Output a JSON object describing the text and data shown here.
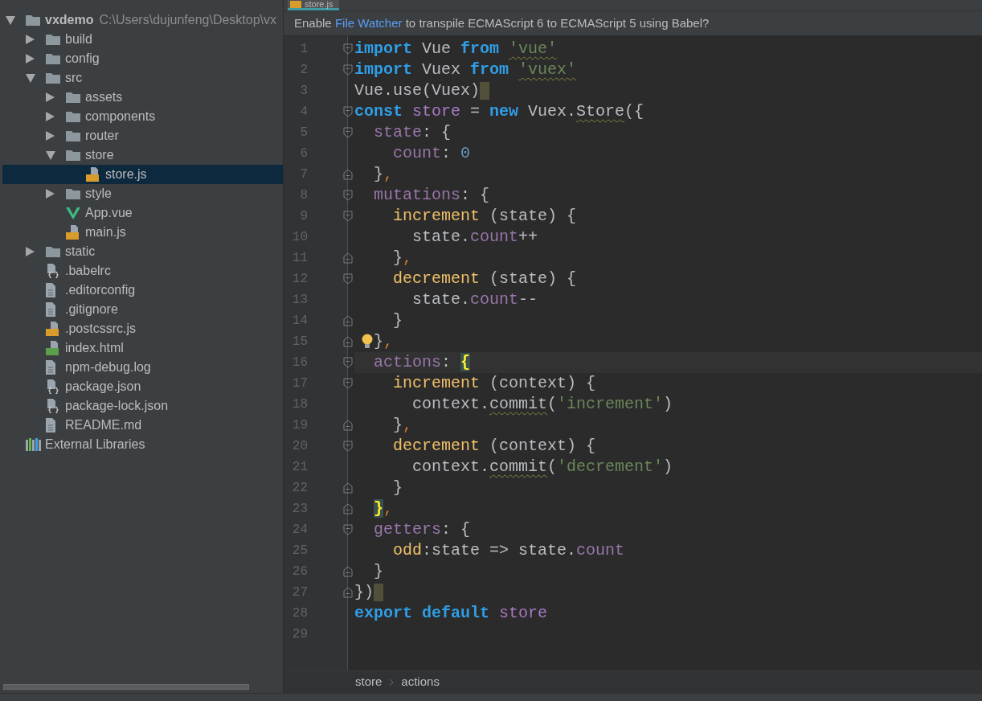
{
  "project_tree": {
    "items": [
      {
        "name": "vxdemo",
        "kind": "project",
        "path": "C:\\Users\\dujunfeng\\Desktop\\vx",
        "expanded": true,
        "selected": false,
        "children": [
          {
            "name": "build",
            "kind": "folder",
            "expanded": false,
            "selected": false
          },
          {
            "name": "config",
            "kind": "folder",
            "expanded": false,
            "selected": false
          },
          {
            "name": "src",
            "kind": "folder",
            "expanded": true,
            "selected": false,
            "children": [
              {
                "name": "assets",
                "kind": "folder",
                "expanded": false,
                "selected": false
              },
              {
                "name": "components",
                "kind": "folder",
                "expanded": false,
                "selected": false
              },
              {
                "name": "router",
                "kind": "folder",
                "expanded": false,
                "selected": false
              },
              {
                "name": "store",
                "kind": "folder",
                "expanded": true,
                "selected": false,
                "children": [
                  {
                    "name": "store.js",
                    "kind": "js",
                    "selected": true
                  }
                ]
              },
              {
                "name": "style",
                "kind": "folder",
                "expanded": false,
                "selected": false
              },
              {
                "name": "App.vue",
                "kind": "vue",
                "selected": false
              },
              {
                "name": "main.js",
                "kind": "js",
                "selected": false
              }
            ]
          },
          {
            "name": "static",
            "kind": "folder",
            "expanded": false,
            "selected": false
          },
          {
            "name": ".babelrc",
            "kind": "json",
            "selected": false
          },
          {
            "name": ".editorconfig",
            "kind": "text",
            "selected": false
          },
          {
            "name": ".gitignore",
            "kind": "text",
            "selected": false
          },
          {
            "name": ".postcssrc.js",
            "kind": "js",
            "selected": false
          },
          {
            "name": "index.html",
            "kind": "html",
            "selected": false
          },
          {
            "name": "npm-debug.log",
            "kind": "text",
            "selected": false
          },
          {
            "name": "package.json",
            "kind": "json",
            "selected": false
          },
          {
            "name": "package-lock.json",
            "kind": "json",
            "selected": false
          },
          {
            "name": "README.md",
            "kind": "text",
            "selected": false
          }
        ]
      },
      {
        "name": "External Libraries",
        "kind": "libraries",
        "selected": false
      }
    ]
  },
  "editor": {
    "tabs": [
      {
        "label": "store.js",
        "kind": "js",
        "selected": true
      }
    ],
    "notification": {
      "parts": [
        {
          "text": "Enable",
          "kind": "text"
        },
        {
          "text": "File Watcher",
          "kind": "link"
        },
        {
          "text": "to transpile ECMAScript 6 to ECMAScript 5 using Babel?",
          "kind": "text"
        }
      ]
    },
    "lines": [
      {
        "number": "1",
        "kind": "fold_start",
        "current": false,
        "bulb": false,
        "end_mark": false,
        "tokens": [
          {
            "text": "import",
            "kind": "keyword"
          },
          {
            "text": " Vue ",
            "kind": "plain"
          },
          {
            "text": "from ",
            "kind": "keyword"
          },
          {
            "text": "'vue'",
            "kind": "string",
            "squiggly": true
          }
        ]
      },
      {
        "number": "2",
        "kind": "fold_start",
        "current": false,
        "bulb": false,
        "end_mark": false,
        "tokens": [
          {
            "text": "import",
            "kind": "keyword"
          },
          {
            "text": " Vuex ",
            "kind": "plain"
          },
          {
            "text": "from ",
            "kind": "keyword"
          },
          {
            "text": "'vuex'",
            "kind": "string",
            "squiggly": true
          }
        ]
      },
      {
        "number": "3",
        "kind": "plain",
        "current": false,
        "bulb": false,
        "end_mark": true,
        "tokens": [
          {
            "text": "Vue.use(Vuex)",
            "kind": "plain"
          }
        ]
      },
      {
        "number": "4",
        "kind": "fold_start",
        "current": false,
        "bulb": false,
        "end_mark": false,
        "tokens": [
          {
            "text": "const ",
            "kind": "keyword"
          },
          {
            "text": "store",
            "kind": "variable"
          },
          {
            "text": " = ",
            "kind": "plain"
          },
          {
            "text": "new",
            "kind": "keyword"
          },
          {
            "text": " Vuex.",
            "kind": "plain"
          },
          {
            "text": "Store",
            "kind": "plain",
            "squiggly": true
          },
          {
            "text": "({",
            "kind": "plain"
          }
        ]
      },
      {
        "number": "5",
        "kind": "fold_start",
        "current": false,
        "bulb": false,
        "end_mark": false,
        "tokens": [
          {
            "text": "  state",
            "kind": "property"
          },
          {
            "text": ": {",
            "kind": "plain"
          }
        ]
      },
      {
        "number": "6",
        "kind": "plain",
        "current": false,
        "bulb": false,
        "end_mark": false,
        "tokens": [
          {
            "text": "    count",
            "kind": "property"
          },
          {
            "text": ": ",
            "kind": "plain"
          },
          {
            "text": "0",
            "kind": "number"
          }
        ]
      },
      {
        "number": "7",
        "kind": "fold_end",
        "current": false,
        "bulb": false,
        "end_mark": false,
        "tokens": [
          {
            "text": "  }",
            "kind": "plain"
          },
          {
            "text": ",",
            "kind": "comma"
          }
        ]
      },
      {
        "number": "8",
        "kind": "fold_start",
        "current": false,
        "bulb": false,
        "end_mark": false,
        "tokens": [
          {
            "text": "  mutations",
            "kind": "property"
          },
          {
            "text": ": {",
            "kind": "plain"
          }
        ]
      },
      {
        "number": "9",
        "kind": "fold_start",
        "current": false,
        "bulb": false,
        "end_mark": false,
        "tokens": [
          {
            "text": "    increment",
            "kind": "function"
          },
          {
            "text": " (state) {",
            "kind": "plain"
          }
        ]
      },
      {
        "number": "10",
        "kind": "plain",
        "current": false,
        "bulb": false,
        "end_mark": false,
        "tokens": [
          {
            "text": "      state.",
            "kind": "plain"
          },
          {
            "text": "count",
            "kind": "property"
          },
          {
            "text": "++",
            "kind": "plain"
          }
        ]
      },
      {
        "number": "11",
        "kind": "fold_end",
        "current": false,
        "bulb": false,
        "end_mark": false,
        "tokens": [
          {
            "text": "    }",
            "kind": "plain"
          },
          {
            "text": ",",
            "kind": "comma"
          }
        ]
      },
      {
        "number": "12",
        "kind": "fold_start",
        "current": false,
        "bulb": false,
        "end_mark": false,
        "tokens": [
          {
            "text": "    decrement",
            "kind": "function"
          },
          {
            "text": " (state) {",
            "kind": "plain"
          }
        ]
      },
      {
        "number": "13",
        "kind": "plain",
        "current": false,
        "bulb": false,
        "end_mark": false,
        "tokens": [
          {
            "text": "      state.",
            "kind": "plain"
          },
          {
            "text": "count",
            "kind": "property"
          },
          {
            "text": "--",
            "kind": "plain"
          }
        ]
      },
      {
        "number": "14",
        "kind": "fold_end",
        "current": false,
        "bulb": false,
        "end_mark": false,
        "tokens": [
          {
            "text": "    }",
            "kind": "plain"
          }
        ]
      },
      {
        "number": "15",
        "kind": "fold_end",
        "current": false,
        "bulb": true,
        "end_mark": false,
        "tokens": [
          {
            "text": "  }",
            "kind": "plain"
          },
          {
            "text": ",",
            "kind": "comma"
          }
        ]
      },
      {
        "number": "16",
        "kind": "fold_start",
        "current": true,
        "bulb": false,
        "end_mark": false,
        "tokens": [
          {
            "text": "  actions",
            "kind": "property"
          },
          {
            "text": ": ",
            "kind": "plain"
          },
          {
            "text": "{",
            "kind": "brace"
          }
        ]
      },
      {
        "number": "17",
        "kind": "fold_start",
        "current": false,
        "bulb": false,
        "end_mark": false,
        "tokens": [
          {
            "text": "    increment",
            "kind": "function"
          },
          {
            "text": " (context) {",
            "kind": "plain"
          }
        ]
      },
      {
        "number": "18",
        "kind": "plain",
        "current": false,
        "bulb": false,
        "end_mark": false,
        "tokens": [
          {
            "text": "      context.",
            "kind": "plain"
          },
          {
            "text": "commit",
            "kind": "plain",
            "squiggly": true
          },
          {
            "text": "(",
            "kind": "plain"
          },
          {
            "text": "'increment'",
            "kind": "string"
          },
          {
            "text": ")",
            "kind": "plain"
          }
        ]
      },
      {
        "number": "19",
        "kind": "fold_end",
        "current": false,
        "bulb": false,
        "end_mark": false,
        "tokens": [
          {
            "text": "    }",
            "kind": "plain"
          },
          {
            "text": ",",
            "kind": "comma"
          }
        ]
      },
      {
        "number": "20",
        "kind": "fold_start",
        "current": false,
        "bulb": false,
        "end_mark": false,
        "tokens": [
          {
            "text": "    decrement",
            "kind": "function"
          },
          {
            "text": " (context) {",
            "kind": "plain"
          }
        ]
      },
      {
        "number": "21",
        "kind": "plain",
        "current": false,
        "bulb": false,
        "end_mark": false,
        "tokens": [
          {
            "text": "      context.",
            "kind": "plain"
          },
          {
            "text": "commit",
            "kind": "plain",
            "squiggly": true
          },
          {
            "text": "(",
            "kind": "plain"
          },
          {
            "text": "'decrement'",
            "kind": "string"
          },
          {
            "text": ")",
            "kind": "plain"
          }
        ]
      },
      {
        "number": "22",
        "kind": "fold_end",
        "current": false,
        "bulb": false,
        "end_mark": false,
        "tokens": [
          {
            "text": "    }",
            "kind": "plain"
          }
        ]
      },
      {
        "number": "23",
        "kind": "fold_end",
        "current": false,
        "bulb": false,
        "end_mark": false,
        "tokens": [
          {
            "text": "  }",
            "kind": "brace"
          },
          {
            "text": ",",
            "kind": "comma"
          }
        ]
      },
      {
        "number": "24",
        "kind": "fold_start",
        "current": false,
        "bulb": false,
        "end_mark": false,
        "tokens": [
          {
            "text": "  getters",
            "kind": "property"
          },
          {
            "text": ": {",
            "kind": "plain"
          }
        ]
      },
      {
        "number": "25",
        "kind": "plain",
        "current": false,
        "bulb": false,
        "end_mark": false,
        "tokens": [
          {
            "text": "    odd",
            "kind": "function"
          },
          {
            "text": ":state => state.",
            "kind": "plain"
          },
          {
            "text": "count",
            "kind": "property"
          }
        ]
      },
      {
        "number": "26",
        "kind": "fold_end",
        "current": false,
        "bulb": false,
        "end_mark": false,
        "tokens": [
          {
            "text": "  }",
            "kind": "plain"
          }
        ]
      },
      {
        "number": "27",
        "kind": "fold_end",
        "current": false,
        "bulb": false,
        "end_mark": true,
        "tokens": [
          {
            "text": "})",
            "kind": "plain"
          }
        ]
      },
      {
        "number": "28",
        "kind": "plain",
        "current": false,
        "bulb": false,
        "end_mark": false,
        "tokens": [
          {
            "text": "export default ",
            "kind": "keyword"
          },
          {
            "text": "store",
            "kind": "variable"
          }
        ]
      },
      {
        "number": "29",
        "kind": "plain",
        "current": false,
        "bulb": false,
        "end_mark": false
      }
    ],
    "breadcrumbs": [
      {
        "label": "store"
      },
      {
        "label": "actions"
      }
    ]
  }
}
